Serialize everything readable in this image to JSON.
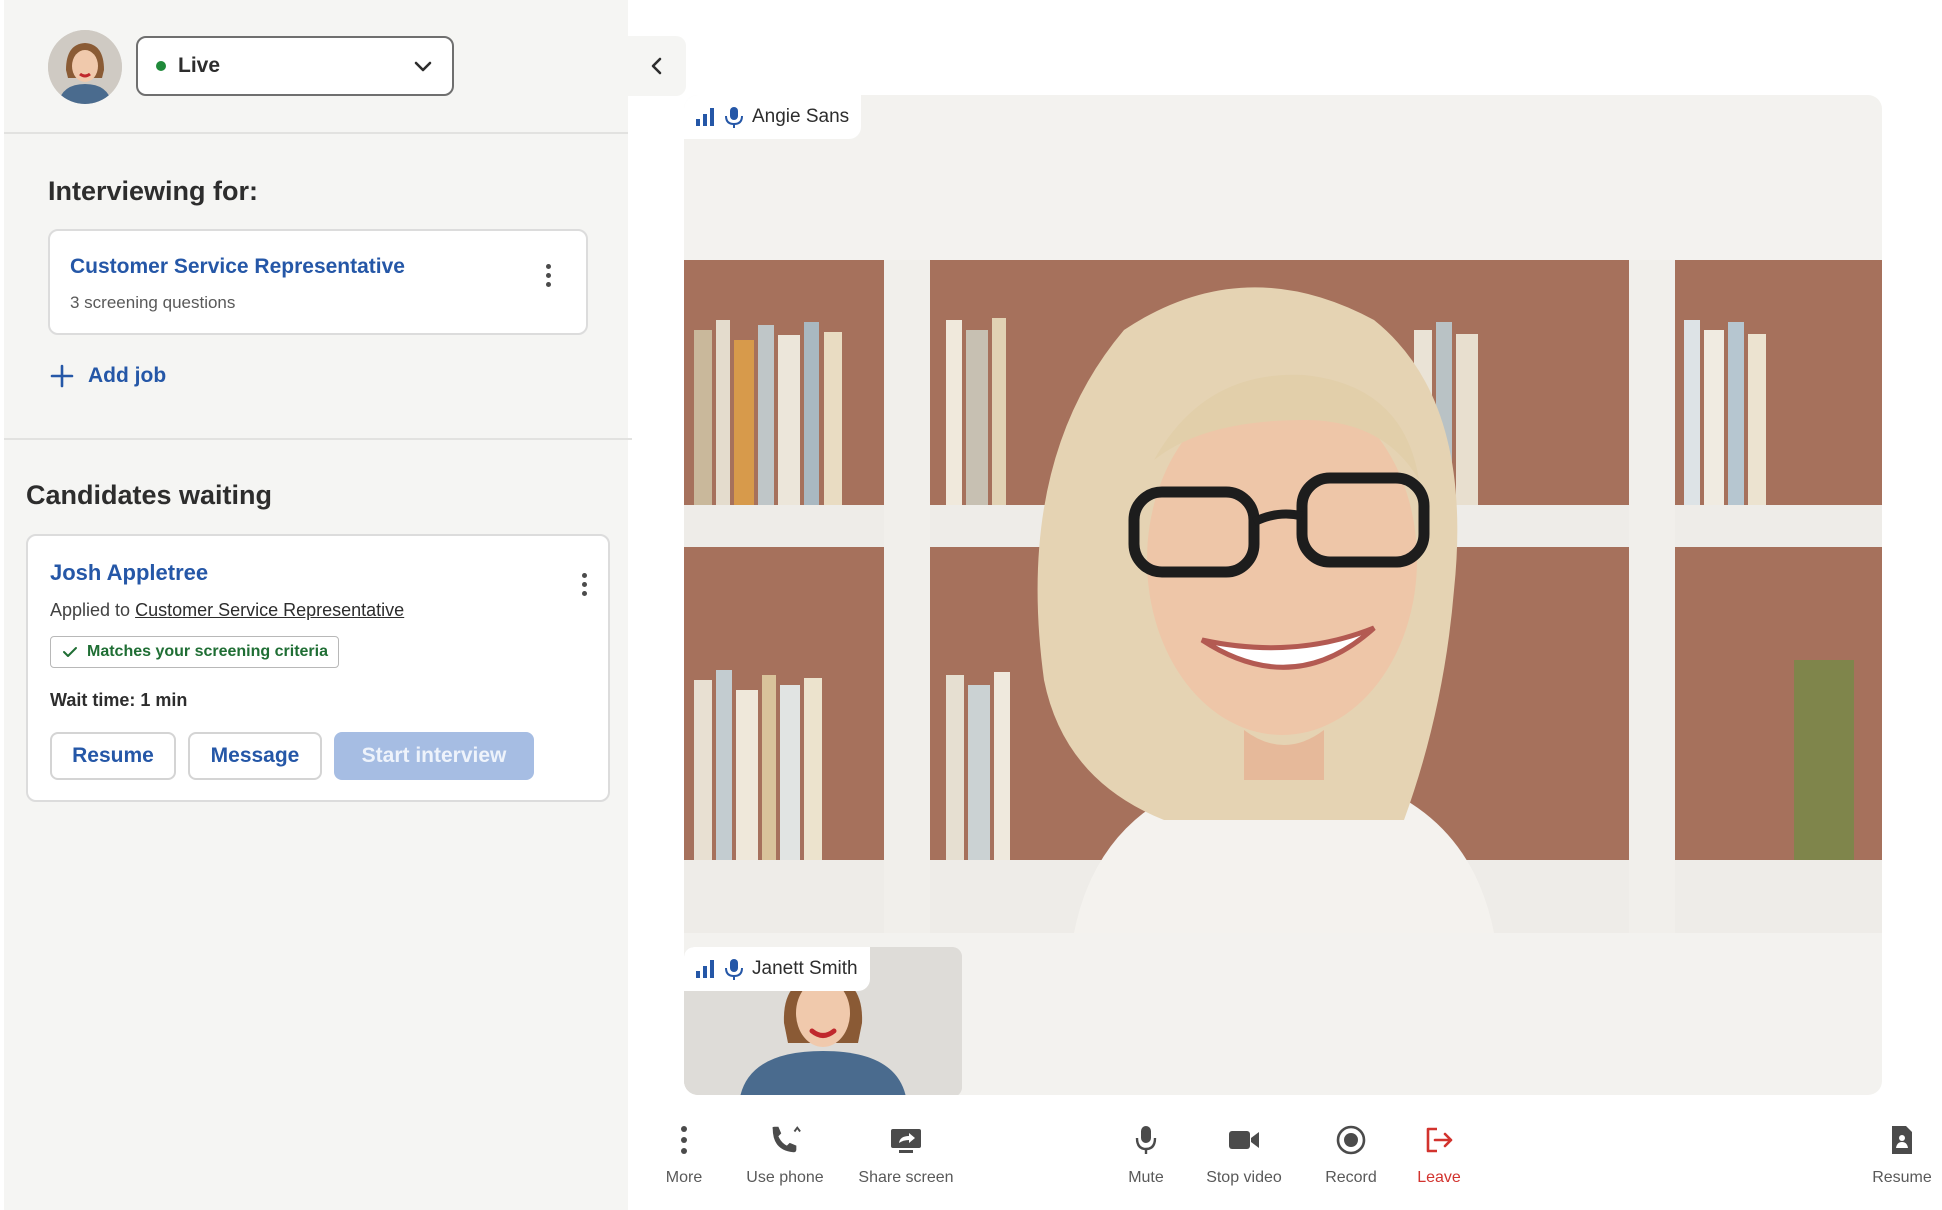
{
  "status": {
    "label": "Live",
    "color": "#1f8a3a"
  },
  "interviewing": {
    "title": "Interviewing for:",
    "job": {
      "title": "Customer Service Representative",
      "subtitle": "3 screening questions"
    },
    "add_job_label": "Add job"
  },
  "candidates": {
    "title": "Candidates waiting",
    "items": [
      {
        "name": "Josh Appletree",
        "applied_prefix": "Applied to",
        "applied_job": "Customer Service Representative",
        "badge": "Matches your screening criteria",
        "wait_time": "Wait time: 1 min",
        "buttons": {
          "resume": "Resume",
          "message": "Message",
          "start": "Start interview"
        }
      }
    ]
  },
  "video": {
    "main_participant": "Angie Sans",
    "self_participant": "Janett Smith"
  },
  "toolbar": {
    "more": "More",
    "use_phone": "Use phone",
    "share_screen": "Share screen",
    "mute": "Mute",
    "stop_video": "Stop video",
    "record": "Record",
    "leave": "Leave",
    "resume": "Resume"
  },
  "colors": {
    "accent": "#2557a7",
    "leave": "#d2332e",
    "success": "#1f6e34"
  }
}
